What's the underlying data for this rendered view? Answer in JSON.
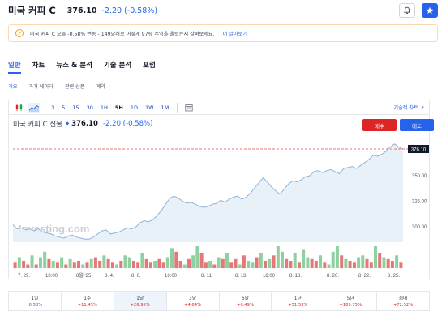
{
  "header": {
    "title": "미국 커피 C",
    "price": "376.10",
    "change": "-2.20 (-0.58%)"
  },
  "banner": {
    "text": "미국 커피 C 오늘 -0.58% 변동 - 149달러로 어떻게 97% 수익을 올렸는지 살펴보세요.",
    "link": "더 알아보기"
  },
  "tabs": [
    "일반",
    "차트",
    "뉴스 & 분석",
    "기술 분석",
    "포럼"
  ],
  "subtabs": [
    "개요",
    "과거 데이터",
    "관련 상품",
    "계약"
  ],
  "toolbar": {
    "timeframes": [
      "1",
      "5",
      "15",
      "30",
      "1H",
      "5H",
      "1D",
      "1W",
      "1M"
    ],
    "active_timeframe": "5H",
    "technical_link": "기술적 차트"
  },
  "chart_header": {
    "name": "미국 커피 C 선물",
    "price": "376.10",
    "change": "-2.20 (-0.58%)",
    "sell_label": "매수",
    "buy_label": "매도"
  },
  "chart_data": {
    "type": "area",
    "watermark": "Investing.com",
    "x_tick_labels": [
      "7. 29.",
      "18:00",
      "8월 '25",
      "8. 4.",
      "8. 6.",
      "16:00",
      "8. 11.",
      "8. 13.",
      "18:00",
      "8. 18.",
      "8. 20.",
      "8. 22.",
      "8. 25."
    ],
    "y_tick_labels": [
      "300.00",
      "325.00",
      "350.00"
    ],
    "last_price_label": "376.10",
    "ylim": [
      285,
      388
    ],
    "price_values": [
      302,
      298,
      299,
      297,
      298,
      296,
      298,
      295,
      294,
      293,
      291,
      290,
      289,
      291,
      292,
      290,
      289,
      288,
      288,
      290,
      293,
      296,
      297,
      293,
      294,
      295,
      297,
      299,
      298,
      300,
      304,
      306,
      305,
      307,
      311,
      316,
      322,
      328,
      330,
      328,
      325,
      323,
      324,
      322,
      320,
      319,
      320,
      322,
      323,
      326,
      324,
      327,
      329,
      330,
      327,
      329,
      333,
      338,
      343,
      348,
      344,
      339,
      335,
      332,
      337,
      342,
      345,
      344,
      346,
      349,
      350,
      354,
      355,
      353,
      355,
      356,
      354,
      352,
      357,
      358,
      359,
      357,
      360,
      363,
      366,
      370,
      369,
      371,
      374,
      378,
      381,
      378,
      376
    ],
    "volume_values": [
      3,
      6,
      4,
      2,
      7,
      2,
      6,
      9,
      5,
      4,
      3,
      6,
      2,
      5,
      3,
      4,
      2,
      3,
      5,
      6,
      4,
      7,
      5,
      3,
      2,
      4,
      7,
      6,
      4,
      3,
      8,
      5,
      3,
      4,
      5,
      3,
      6,
      11,
      9,
      4,
      2,
      5,
      7,
      12,
      8,
      3,
      4,
      2,
      6,
      5,
      8,
      3,
      5,
      2,
      7,
      4,
      3,
      6,
      8,
      4,
      5,
      7,
      12,
      9,
      5,
      4,
      8,
      3,
      10,
      6,
      5,
      4,
      7,
      3,
      2,
      9,
      12,
      7,
      5,
      4,
      3,
      6,
      7,
      5,
      3,
      12,
      8,
      6,
      5,
      4,
      7,
      3
    ],
    "volume_up": [
      false,
      true,
      false,
      false,
      true,
      false,
      true,
      true,
      false,
      true,
      false,
      true,
      false,
      true,
      false,
      false,
      true,
      false,
      true,
      false,
      false,
      true,
      false,
      false,
      true,
      false,
      true,
      true,
      false,
      false,
      true,
      false,
      false,
      true,
      false,
      false,
      true,
      true,
      false,
      false,
      true,
      false,
      true,
      true,
      false,
      false,
      true,
      false,
      true,
      false,
      true,
      false,
      false,
      true,
      false,
      true,
      true,
      false,
      true,
      false,
      true,
      false,
      true,
      true,
      false,
      false,
      true,
      false,
      true,
      true,
      false,
      false,
      true,
      false,
      true,
      true,
      true,
      false,
      true,
      false,
      false,
      true,
      true,
      false,
      false,
      true,
      false,
      true,
      false,
      false,
      true,
      false
    ],
    "colors": {
      "line": "#8cb4d8",
      "area": "#e5eef7",
      "vol_up": "#8fd0a0",
      "vol_down": "#e47878",
      "dashed": "#e04a4a"
    }
  },
  "periods": [
    {
      "label": "1일",
      "value": "-0.58%",
      "dir": "neg"
    },
    {
      "label": "1주",
      "value": "+11.45%",
      "dir": "pos"
    },
    {
      "label": "1달",
      "value": "+26.95%",
      "dir": "pos",
      "active": true
    },
    {
      "label": "3달",
      "value": "+4.64%",
      "dir": "pos"
    },
    {
      "label": "6달",
      "value": "+0.49%",
      "dir": "pos"
    },
    {
      "label": "1년",
      "value": "+51.53%",
      "dir": "pos"
    },
    {
      "label": "5년",
      "value": "+189.75%",
      "dir": "pos"
    },
    {
      "label": "최대",
      "value": "+72.52%",
      "dir": "pos"
    }
  ]
}
